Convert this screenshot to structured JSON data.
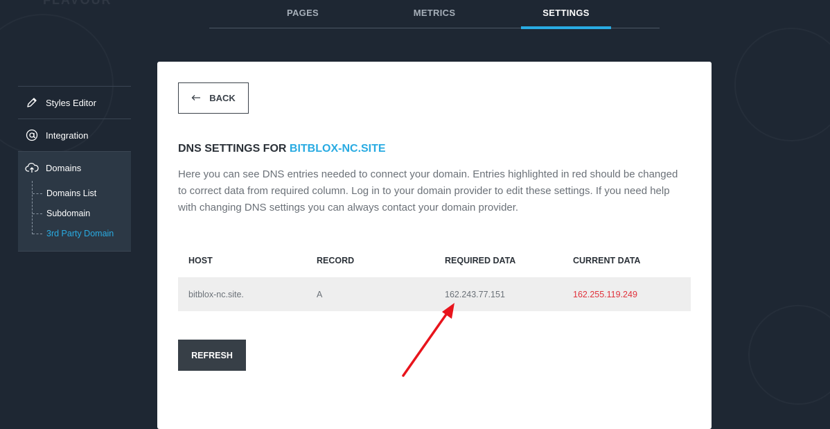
{
  "brand": "FLAVOUR",
  "tabs": [
    {
      "label": "PAGES"
    },
    {
      "label": "METRICS"
    },
    {
      "label": "SETTINGS"
    }
  ],
  "sidebar": {
    "items": [
      {
        "label": "Styles Editor",
        "icon": "pencil-icon"
      },
      {
        "label": "Integration",
        "icon": "at-icon"
      },
      {
        "label": "Domains",
        "icon": "cloud-upload-icon"
      }
    ],
    "domains_sub": [
      {
        "label": "Domains List"
      },
      {
        "label": "Subdomain"
      },
      {
        "label": "3rd Party Domain"
      }
    ]
  },
  "card": {
    "back_label": "BACK",
    "title_prefix": "DNS SETTINGS FOR ",
    "title_domain": "BITBLOX-NC.SITE",
    "description": "Here you can see DNS entries needed to connect your domain. Entries highlighted in red should be changed to correct data from required column. Log in to your domain provider to edit these settings. If you need help with changing DNS settings you can always contact your domain provider.",
    "table": {
      "headers": [
        "HOST",
        "RECORD",
        "REQUIRED DATA",
        "CURRENT DATA"
      ],
      "rows": [
        [
          "bitblox-nc.site.",
          "A",
          "162.243.77.151",
          "162.255.119.249"
        ]
      ]
    },
    "refresh_label": "REFRESH"
  },
  "colors": {
    "accent": "#29abe2",
    "error": "#e0323c",
    "annotation_arrow": "#e8141c"
  }
}
